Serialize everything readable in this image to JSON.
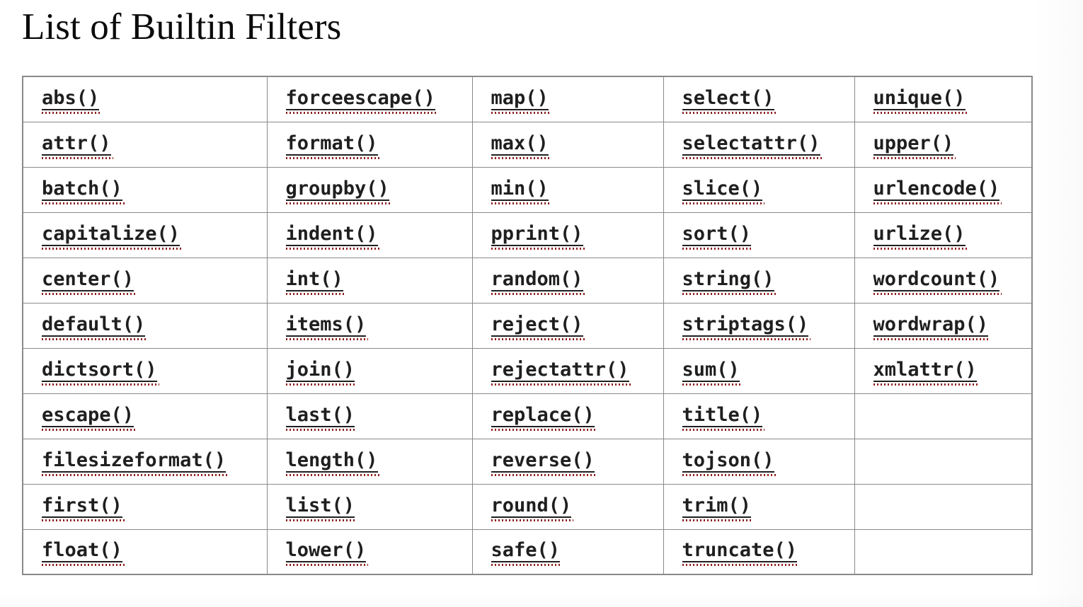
{
  "page": {
    "title": "List of Builtin Filters",
    "background_color": "#ffffff",
    "text_color": "#1f1f1f",
    "border_color": "#8a8a8a",
    "spellcheck_underline_color": "#8c1f1f"
  },
  "table": {
    "name": "builtin-filters-table",
    "rows": 11,
    "columns": 5,
    "cells": [
      [
        "abs()",
        "forceescape()",
        "map()",
        "select()",
        "unique()"
      ],
      [
        "attr()",
        "format()",
        "max()",
        "selectattr()",
        "upper()"
      ],
      [
        "batch()",
        "groupby()",
        "min()",
        "slice()",
        "urlencode()"
      ],
      [
        "capitalize()",
        "indent()",
        "pprint()",
        "sort()",
        "urlize()"
      ],
      [
        "center()",
        "int()",
        "random()",
        "string()",
        "wordcount()"
      ],
      [
        "default()",
        "items()",
        "reject()",
        "striptags()",
        "wordwrap()"
      ],
      [
        "dictsort()",
        "join()",
        "rejectattr()",
        "sum()",
        "xmlattr()"
      ],
      [
        "escape()",
        "last()",
        "replace()",
        "title()",
        ""
      ],
      [
        "filesizeformat()",
        "length()",
        "reverse()",
        "tojson()",
        ""
      ],
      [
        "first()",
        "list()",
        "round()",
        "trim()",
        ""
      ],
      [
        "float()",
        "lower()",
        "safe()",
        "truncate()",
        ""
      ]
    ]
  }
}
